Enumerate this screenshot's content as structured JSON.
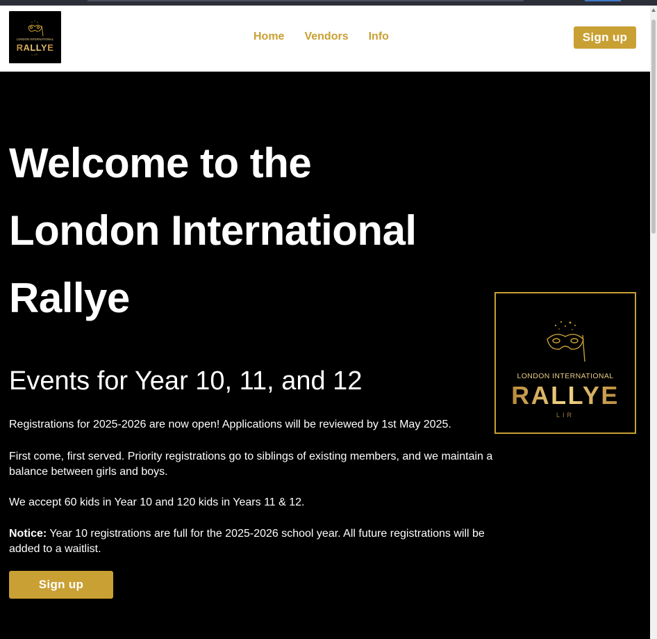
{
  "colors": {
    "accent": "#c9a033",
    "background": "#000000",
    "navbar_bg": "#ffffff",
    "text": "#ffffff"
  },
  "navbar": {
    "logo": {
      "icon": "masquerade-mask-icon",
      "line1": "LONDON INTERNATIONAL",
      "line2": "RALLYE",
      "line3": "LIR"
    },
    "links": [
      "Home",
      "Vendors",
      "Info"
    ],
    "signup_label": "Sign up"
  },
  "hero": {
    "title": "Welcome to the London International Rallye",
    "subtitle": "Events for Year 10, 11, and 12",
    "p1": "Registrations for 2025-2026 are now open! Applications will be reviewed by 1st May 2025.",
    "p2": "First come, first served. Priority registrations go to siblings of existing members, and we maintain a balance between girls and boys.",
    "p3": "We accept 60 kids in Year 10 and 120 kids in Years 11 & 12.",
    "notice_label": "Notice:",
    "notice_text": " Year 10 registrations are full for the 2025-2026 school year. All future registrations will be added to a waitlist.",
    "signup_label": "Sign up"
  },
  "side_logo": {
    "icon": "masquerade-mask-icon",
    "line1": "LONDON INTERNATIONAL",
    "line2": "RALLYE",
    "line3": "LIR"
  }
}
